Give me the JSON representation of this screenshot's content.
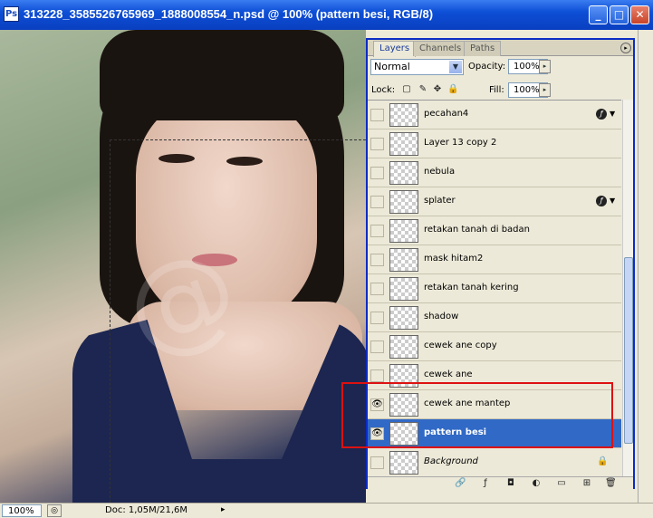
{
  "window": {
    "title": "313228_3585526765969_1888008554_n.psd @ 100% (pattern besi, RGB/8)",
    "app_icon": "ps-icon",
    "minimize": "_",
    "maximize": "□",
    "close": "✕"
  },
  "statusbar": {
    "zoom": "100%",
    "doc_info": "Doc: 1,05M/21,6M",
    "nav_icon": "▸"
  },
  "canvas": {
    "watermark": "@"
  },
  "panel": {
    "tabs": [
      {
        "label": "Layers"
      },
      {
        "label": "Channels"
      },
      {
        "label": "Paths"
      }
    ],
    "blend_mode": "Normal",
    "opacity_label": "Opacity:",
    "opacity_value": "100%",
    "lock_label": "Lock:",
    "fill_label": "Fill:",
    "fill_value": "100%",
    "menu_icon": "▸",
    "dropdown_arrow": "▼",
    "spin_arrow": "▸",
    "lock_icons": [
      "▢",
      "✎",
      "✥",
      "🔒"
    ]
  },
  "layers": [
    {
      "name": "pecahan4",
      "visible": false,
      "fx": true
    },
    {
      "name": "Layer 13 copy 2",
      "visible": false,
      "fx": false
    },
    {
      "name": "nebula",
      "visible": false,
      "fx": false
    },
    {
      "name": "splater",
      "visible": false,
      "fx": true
    },
    {
      "name": "retakan tanah di badan",
      "visible": false,
      "fx": false
    },
    {
      "name": "mask hitam2",
      "visible": false,
      "fx": false
    },
    {
      "name": "retakan tanah kering",
      "visible": false,
      "fx": false
    },
    {
      "name": "shadow",
      "visible": false,
      "fx": false
    },
    {
      "name": "cewek ane copy",
      "visible": false,
      "fx": false
    },
    {
      "name": "cewek ane",
      "visible": false,
      "fx": false
    },
    {
      "name": "cewek ane mantep",
      "visible": true,
      "fx": false
    },
    {
      "name": "pattern besi",
      "visible": true,
      "fx": false,
      "selected": true
    },
    {
      "name": "Background",
      "visible": false,
      "fx": false,
      "locked": true
    }
  ],
  "layer_glyphs": {
    "eye": "👁",
    "fx": "ƒ",
    "fx_arrow": "▼",
    "lock": "🔒"
  },
  "footer_icons": [
    "🔗",
    "ƒ",
    "◘",
    "◐",
    "▭",
    "⊞",
    "🗑"
  ]
}
